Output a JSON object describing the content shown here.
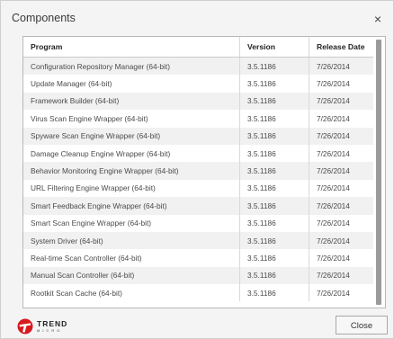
{
  "dialog": {
    "title": "Components",
    "close_icon": "×",
    "close_button_label": "Close"
  },
  "table": {
    "headers": [
      "Program",
      "Version",
      "Release Date"
    ],
    "rows": [
      [
        "Configuration Repository Manager (64-bit)",
        "3.5.1186",
        "7/26/2014"
      ],
      [
        "Update Manager (64-bit)",
        "3.5.1186",
        "7/26/2014"
      ],
      [
        "Framework Builder (64-bit)",
        "3.5.1186",
        "7/26/2014"
      ],
      [
        "Virus Scan Engine Wrapper (64-bit)",
        "3.5.1186",
        "7/26/2014"
      ],
      [
        "Spyware Scan Engine Wrapper (64-bit)",
        "3.5.1186",
        "7/26/2014"
      ],
      [
        "Damage Cleanup Engine Wrapper (64-bit)",
        "3.5.1186",
        "7/26/2014"
      ],
      [
        "Behavior Monitoring Engine Wrapper (64-bit)",
        "3.5.1186",
        "7/26/2014"
      ],
      [
        "URL Filtering Engine Wrapper (64-bit)",
        "3.5.1186",
        "7/26/2014"
      ],
      [
        "Smart Feedback Engine Wrapper (64-bit)",
        "3.5.1186",
        "7/26/2014"
      ],
      [
        "Smart Scan Engine Wrapper (64-bit)",
        "3.5.1186",
        "7/26/2014"
      ],
      [
        "System Driver (64-bit)",
        "3.5.1186",
        "7/26/2014"
      ],
      [
        "Real-time Scan Controller (64-bit)",
        "3.5.1186",
        "7/26/2014"
      ],
      [
        "Manual Scan Controller (64-bit)",
        "3.5.1186",
        "7/26/2014"
      ],
      [
        "Rootkit Scan Cache (64-bit)",
        "3.5.1186",
        "7/26/2014"
      ]
    ]
  },
  "logo": {
    "brand_word": "TREND",
    "brand_sub": "MICRO",
    "icon": "trend-micro-logo-icon",
    "color": "#d71920"
  }
}
